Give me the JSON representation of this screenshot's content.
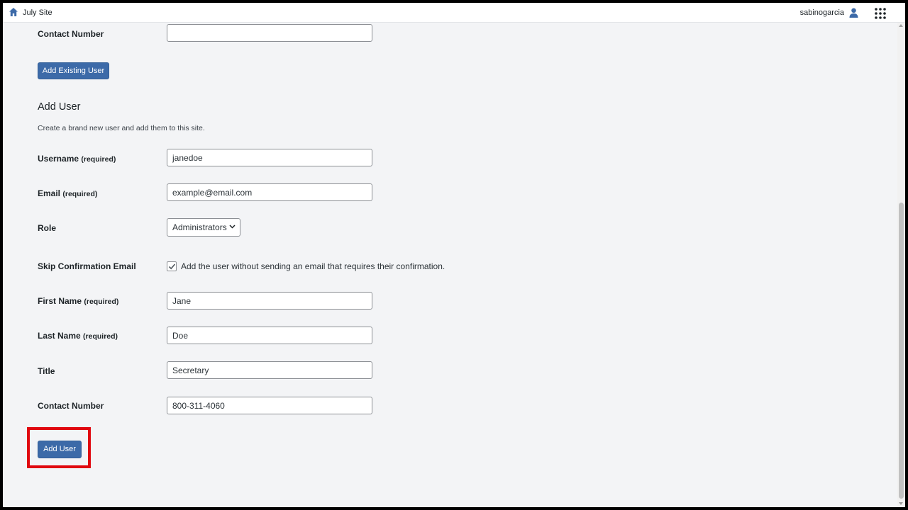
{
  "topbar": {
    "site_title": "July Site",
    "username": "sabinogarcia"
  },
  "existing_user": {
    "contact_label": "Contact Number",
    "contact_value": "",
    "add_button": "Add Existing User"
  },
  "add_user": {
    "title": "Add User",
    "description": "Create a brand new user and add them to this site.",
    "username_label": "Username",
    "username_req": "(required)",
    "username_value": "janedoe",
    "email_label": "Email",
    "email_req": "(required)",
    "email_value": "example@email.com",
    "role_label": "Role",
    "role_value": "Administrators",
    "skip_label": "Skip Confirmation Email",
    "skip_checked": true,
    "skip_text": "Add the user without sending an email that requires their confirmation.",
    "first_label": "First Name",
    "first_req": "(required)",
    "first_value": "Jane",
    "last_label": "Last Name",
    "last_req": "(required)",
    "last_value": "Doe",
    "title_label": "Title",
    "title_value": "Secretary",
    "contact_label": "Contact Number",
    "contact_value": "800-311-4060",
    "submit_button": "Add User"
  },
  "colors": {
    "accent": "#3c6aa8",
    "highlight": "#e0070f",
    "background": "#f3f4f6"
  },
  "icons": [
    "home-icon",
    "user-icon",
    "apps-grid-icon",
    "chevron-down-icon",
    "checkmark-icon"
  ]
}
